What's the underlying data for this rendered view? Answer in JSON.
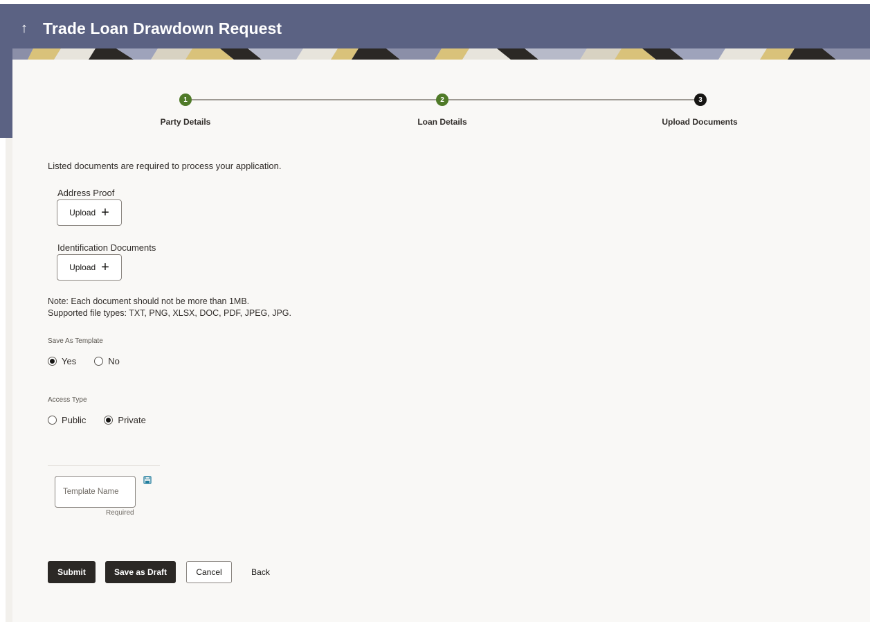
{
  "header": {
    "title": "Trade Loan Drawdown Request"
  },
  "stepper": {
    "steps": [
      {
        "number": "1",
        "label": "Party Details",
        "state": "done"
      },
      {
        "number": "2",
        "label": "Loan Details",
        "state": "done"
      },
      {
        "number": "3",
        "label": "Upload Documents",
        "state": "active"
      }
    ]
  },
  "documents": {
    "intro": "Listed documents are required to process your application.",
    "items": [
      {
        "label": "Address Proof",
        "button_label": "Upload"
      },
      {
        "label": "Identification Documents",
        "button_label": "Upload"
      }
    ],
    "note_line1": "Note: Each document should not be more than 1MB.",
    "note_line2": "Supported file types: TXT, PNG, XLSX, DOC, PDF, JPEG, JPG."
  },
  "save_as_template": {
    "label": "Save As Template",
    "options": [
      "Yes",
      "No"
    ],
    "selected": "Yes"
  },
  "access_type": {
    "label": "Access Type",
    "options": [
      "Public",
      "Private"
    ],
    "selected": "Private"
  },
  "template_name": {
    "placeholder": "Template Name",
    "value": "",
    "hint": "Required",
    "save_icon": "save-icon"
  },
  "actions": {
    "submit": "Submit",
    "save_draft": "Save as Draft",
    "cancel": "Cancel",
    "back": "Back"
  },
  "colors": {
    "header_bg": "#5b6283",
    "step_done": "#4f7a28",
    "step_active": "#161513",
    "primary_button": "#2b2825",
    "icon_accent": "#227e9e"
  }
}
